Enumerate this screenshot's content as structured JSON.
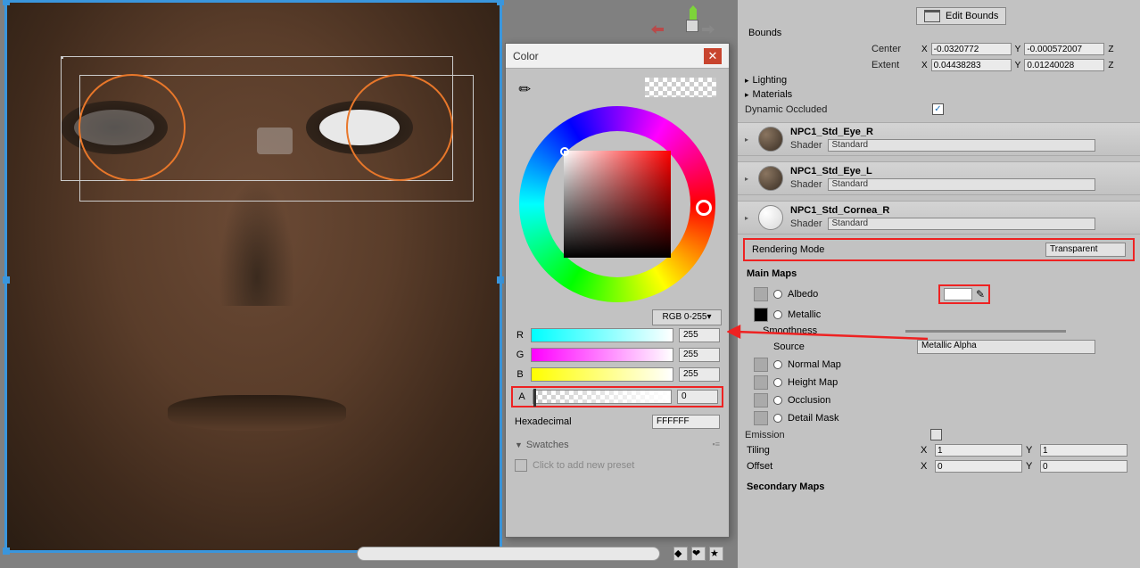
{
  "colorPicker": {
    "title": "Color",
    "modeBtn": "RGB 0-255▾",
    "r": {
      "label": "R",
      "value": "255"
    },
    "g": {
      "label": "G",
      "value": "255"
    },
    "b": {
      "label": "B",
      "value": "255"
    },
    "a": {
      "label": "A",
      "value": "0"
    },
    "hexLabel": "Hexadecimal",
    "hexValue": "FFFFFF",
    "swatchesLabel": "Swatches",
    "presetLabel": "Click to add new preset"
  },
  "inspector": {
    "editBounds": "Edit Bounds",
    "boundsLabel": "Bounds",
    "centerLabel": "Center",
    "extentLabel": "Extent",
    "center": {
      "x": "-0.0320772",
      "y": "-0.000572007",
      "zLabel": "Z"
    },
    "extent": {
      "x": "0.04438283",
      "y": "0.01240028",
      "zLabel": "Z"
    },
    "lighting": "Lighting",
    "materials": "Materials",
    "dynamicOccluded": "Dynamic Occluded",
    "mat1": {
      "name": "NPC1_Std_Eye_R",
      "shaderLabel": "Shader",
      "shaderValue": "Standard"
    },
    "mat2": {
      "name": "NPC1_Std_Eye_L",
      "shaderLabel": "Shader",
      "shaderValue": "Standard"
    },
    "mat3": {
      "name": "NPC1_Std_Cornea_R",
      "shaderLabel": "Shader",
      "shaderValue": "Standard"
    },
    "renderModeLabel": "Rendering Mode",
    "renderModeValue": "Transparent",
    "mainMaps": "Main Maps",
    "albedo": "Albedo",
    "metallic": "Metallic",
    "smoothness": "Smoothness",
    "source": "Source",
    "sourceValue": "Metallic Alpha",
    "normalMap": "Normal Map",
    "heightMap": "Height Map",
    "occlusion": "Occlusion",
    "detailMask": "Detail Mask",
    "emission": "Emission",
    "tiling": "Tiling",
    "offset": "Offset",
    "tilingVals": {
      "x": "1",
      "y": "1"
    },
    "offsetVals": {
      "x": "0",
      "y": "0"
    },
    "secondaryMaps": "Secondary Maps"
  }
}
